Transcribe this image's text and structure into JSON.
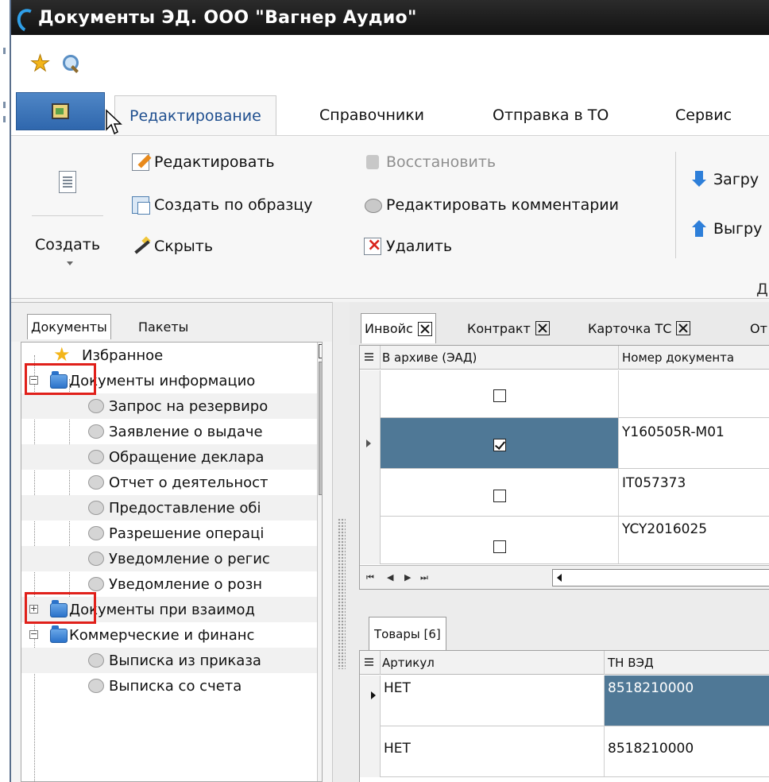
{
  "window": {
    "title": "Документы ЭД. ООО \"Вагнер Аудио\""
  },
  "quick_access": {
    "items": [
      "favorite-star-icon",
      "search-icon"
    ]
  },
  "ribbon_tabs": [
    "Редактирование",
    "Справочники",
    "Отправка в ТО",
    "Сервис"
  ],
  "ribbon": {
    "create": "Создать",
    "edit": "Редактировать",
    "create_from_template": "Создать по образцу",
    "hide": "Скрыть",
    "restore": "Восстановить",
    "edit_comments": "Редактировать комментарии",
    "delete": "Удалить",
    "load": "Загру",
    "unload": "Выгру",
    "group_label": "Д"
  },
  "nav_tabs": [
    "Документы",
    "Пакеты"
  ],
  "tree": [
    {
      "label": "Избранное",
      "icon": "star"
    },
    {
      "label": "Документы информацио",
      "icon": "folder",
      "expanded": true
    },
    {
      "label": "Запрос на резервиро",
      "icon": "doc"
    },
    {
      "label": "Заявление о выдаче",
      "icon": "doc"
    },
    {
      "label": "Обращение деклара",
      "icon": "doc"
    },
    {
      "label": "Отчет о деятельност",
      "icon": "doc"
    },
    {
      "label": "Предоставление обі",
      "icon": "doc"
    },
    {
      "label": "Разрешение операці",
      "icon": "doc"
    },
    {
      "label": "Уведомление о регис",
      "icon": "doc"
    },
    {
      "label": "Уведомление о розн",
      "icon": "doc"
    },
    {
      "label": "Документы при взаимод",
      "icon": "folder",
      "expanded": false
    },
    {
      "label": "Коммерческие и финанс",
      "icon": "folder",
      "expanded": true
    },
    {
      "label": "Выписка из приказа",
      "icon": "doc"
    },
    {
      "label": "Выписка со счета",
      "icon": "doc"
    }
  ],
  "doc_tabs": [
    "Инвойс",
    "Контракт",
    "Карточка ТС",
    "От"
  ],
  "documents_grid": {
    "columns": [
      "В архиве (ЭАД)",
      "Номер документа"
    ],
    "rows": [
      {
        "archived": false,
        "number": ""
      },
      {
        "archived": true,
        "number": "Y160505R-M01",
        "current": true
      },
      {
        "archived": false,
        "number": "IT057373"
      },
      {
        "archived": false,
        "number": "YCY2016025"
      }
    ],
    "navigator": [
      "⏮",
      "◀",
      "▶",
      "⏭"
    ]
  },
  "goods_tab": "Товары [6]",
  "goods_grid": {
    "columns": [
      "Артикул",
      "ТН ВЭД"
    ],
    "rows": [
      {
        "article": "НЕТ",
        "code": "8518210000",
        "current": true
      },
      {
        "article": "НЕТ",
        "code": "8518210000"
      }
    ]
  },
  "colors": {
    "selection": "#4f7896",
    "title_bar": "#1a1a1a",
    "highlight_box": "#e0201a"
  }
}
